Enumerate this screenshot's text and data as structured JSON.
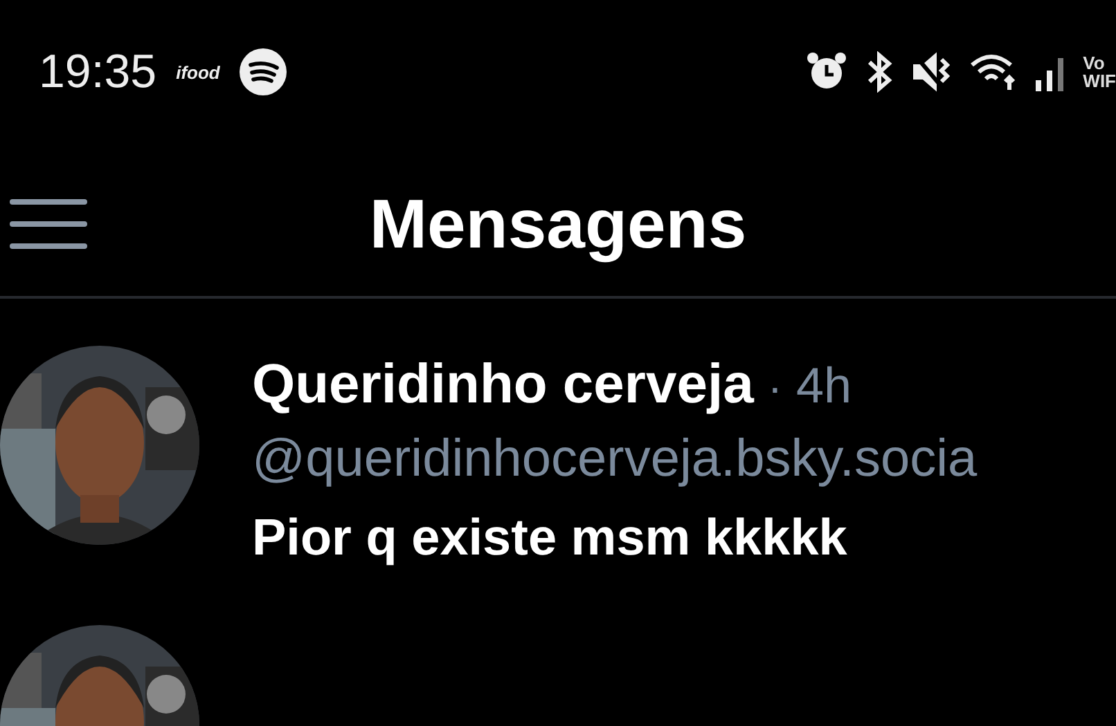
{
  "status_bar": {
    "time": "19:35",
    "app_logo": "ifood",
    "carrier_top": "Vo",
    "carrier_bottom": "WIF"
  },
  "header": {
    "title": "Mensagens"
  },
  "messages": [
    {
      "name": "Queridinho cerveja",
      "separator": "·",
      "time": "4h",
      "handle": "@queridinhocerveja.bsky.socia",
      "text": "Pior q existe msm kkkkk",
      "avatar": {
        "kind": "picture"
      }
    },
    {
      "avatar": {
        "kind": "picture"
      }
    }
  ]
}
